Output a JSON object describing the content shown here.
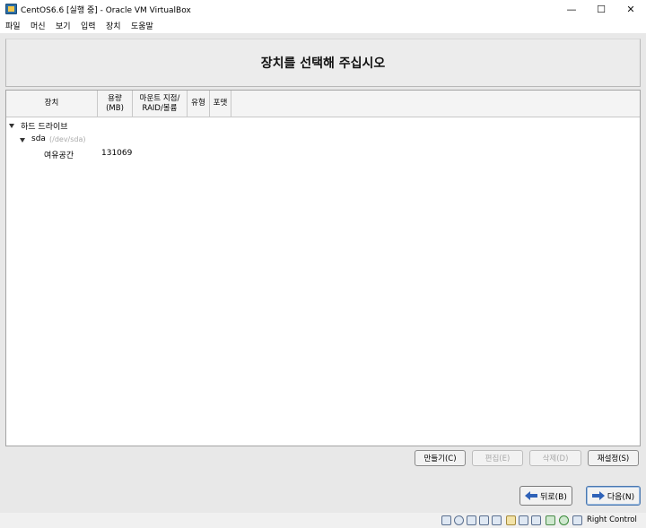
{
  "window": {
    "title": "CentOS6.6 [실행 중] - Oracle VM VirtualBox",
    "minimize_glyph": "—",
    "maximize_glyph": "☐",
    "close_glyph": "✕"
  },
  "menubar": {
    "items": [
      "파일",
      "머신",
      "보기",
      "입력",
      "장치",
      "도움말"
    ]
  },
  "installer": {
    "heading": "장치를 선택해 주십시오",
    "columns": {
      "device": "장치",
      "size": "용량\n(MB)",
      "mount": "마운트 지점/\nRAID/볼륨",
      "type": "유형",
      "format": "포맷"
    },
    "tree": {
      "group_label": "하드 드라이브",
      "disk_name": "sda",
      "disk_path": "(/dev/sda)",
      "free_label": "여유공간",
      "free_size": "131069"
    },
    "actions": {
      "create": "만들기(C)",
      "edit": "편집(E)",
      "delete": "삭제(D)",
      "reset": "재설정(S)"
    },
    "nav": {
      "back": "뒤로(B)",
      "next": "다음(N)"
    }
  },
  "statusbar": {
    "host_key": "Right Control",
    "icons": [
      "hard-disk-icon",
      "optical-drive-icon",
      "audio-icon",
      "network-icon",
      "usb-icon",
      "shared-folder-icon",
      "display-icon",
      "video-capture-icon",
      "cpu-icon",
      "mouse-integration-icon",
      "keyboard-icon"
    ]
  }
}
